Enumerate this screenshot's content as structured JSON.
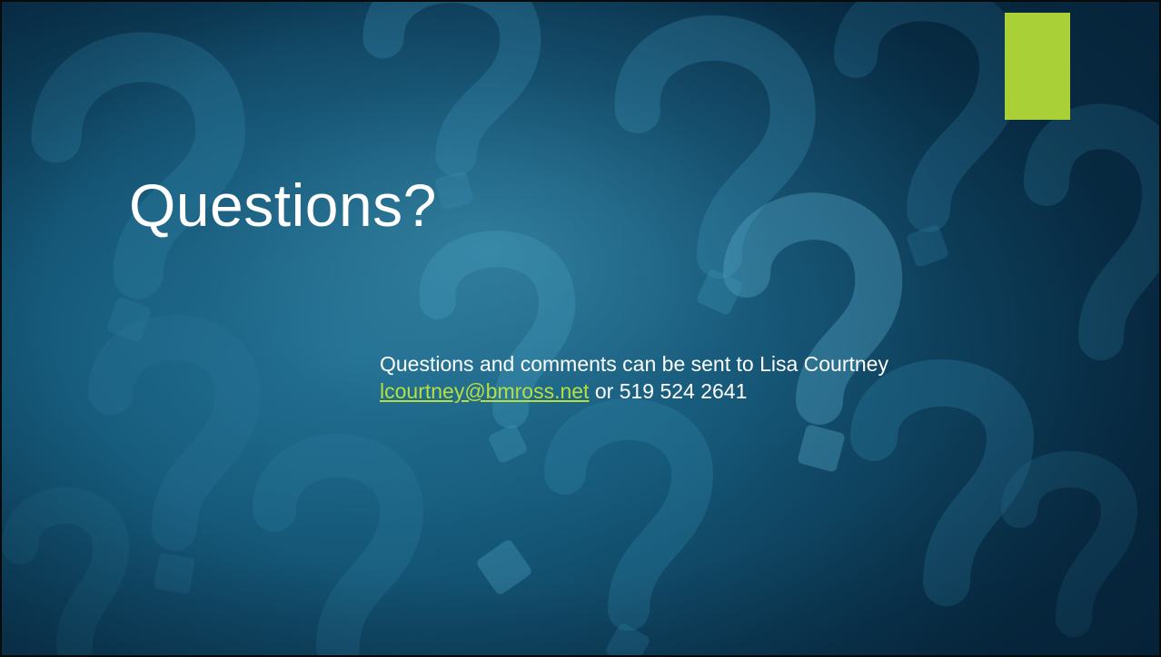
{
  "slide": {
    "title": "Questions?",
    "body": {
      "line1": "Questions and comments can be sent to Lisa Courtney",
      "email": "lcourtney@bmross.net",
      "connector": " or ",
      "phone": "519 524 2641"
    }
  },
  "colors": {
    "accent": "#a9d037",
    "link": "#b6df3f",
    "background": "#145676"
  },
  "background_icon": "question-mark-pattern"
}
